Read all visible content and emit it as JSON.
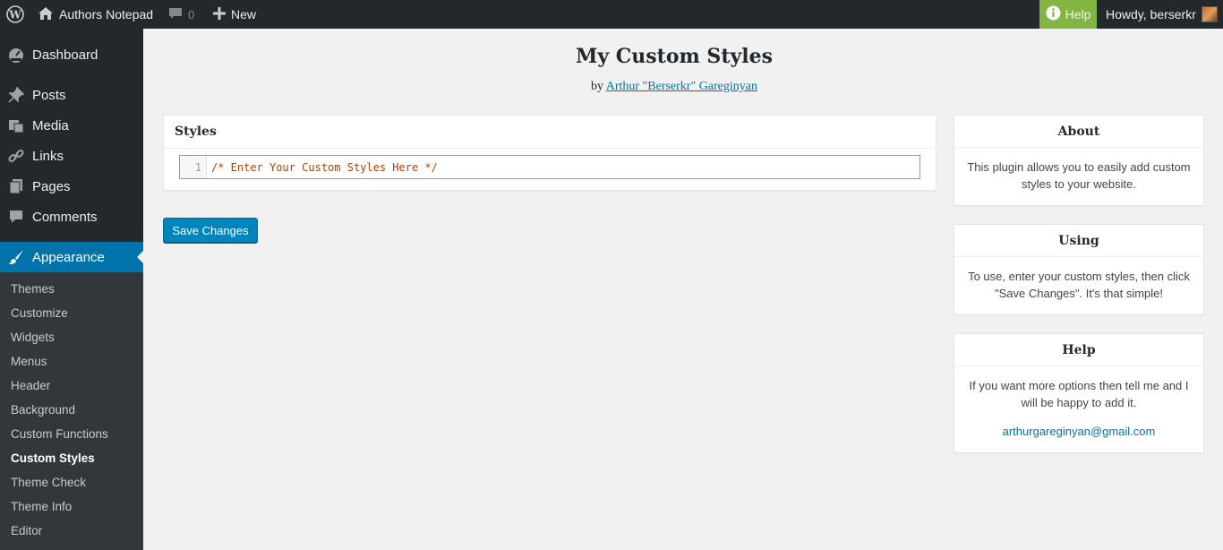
{
  "adminbar": {
    "site_name": "Authors Notepad",
    "comments_count": "0",
    "new_label": "New",
    "help_label": "Help",
    "howdy": "Howdy, berserkr"
  },
  "sidebar": {
    "top_items": [
      {
        "label": "Dashboard",
        "icon": "dashboard-icon"
      },
      {
        "label": "Posts",
        "icon": "pin-icon"
      },
      {
        "label": "Media",
        "icon": "media-icon"
      },
      {
        "label": "Links",
        "icon": "link-icon"
      },
      {
        "label": "Pages",
        "icon": "pages-icon"
      },
      {
        "label": "Comments",
        "icon": "comment-icon"
      },
      {
        "label": "Appearance",
        "icon": "brush-icon"
      }
    ],
    "submenu": [
      "Themes",
      "Customize",
      "Widgets",
      "Menus",
      "Header",
      "Background",
      "Custom Functions",
      "Custom Styles",
      "Theme Check",
      "Theme Info",
      "Editor"
    ],
    "current_submenu": "Custom Styles"
  },
  "main": {
    "title": "My Custom Styles",
    "by": "by",
    "author": "Arthur \"Berserkr\" Gareginyan",
    "styles_panel_title": "Styles",
    "editor": {
      "line_number": "1",
      "code": "/* Enter Your Custom Styles Here */"
    },
    "save_label": "Save Changes"
  },
  "side_boxes": {
    "about": {
      "title": "About",
      "text": "This plugin allows you to easily add custom styles to your website."
    },
    "using": {
      "title": "Using",
      "text": "To use, enter your custom styles, then click \"Save Changes\". It's that simple!"
    },
    "help": {
      "title": "Help",
      "text": "If you want more options then tell me and I will be happy to add it.",
      "email": "arthurgareginyan@gmail.com"
    }
  },
  "colors": {
    "admin_bar": "#23282d",
    "accent": "#0073aa",
    "help": "#82b541",
    "submenu": "#32373c"
  }
}
